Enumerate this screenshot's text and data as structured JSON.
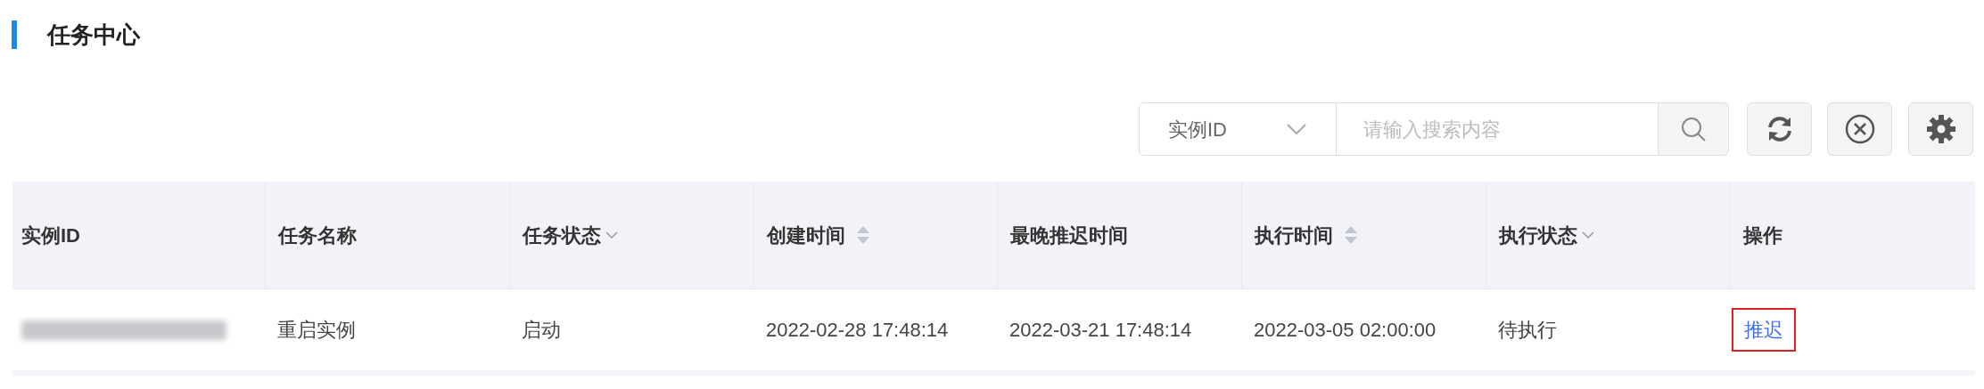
{
  "title": "任务中心",
  "toolbar": {
    "field_select": "实例ID",
    "search": {
      "placeholder": "请输入搜索内容"
    }
  },
  "table": {
    "columns": [
      {
        "label": "实例ID",
        "kind": "plain"
      },
      {
        "label": "任务名称",
        "kind": "plain"
      },
      {
        "label": "任务状态",
        "kind": "filter"
      },
      {
        "label": "创建时间",
        "kind": "sort"
      },
      {
        "label": "最晚推迟时间",
        "kind": "plain"
      },
      {
        "label": "执行时间",
        "kind": "sort"
      },
      {
        "label": "执行状态",
        "kind": "filter"
      },
      {
        "label": "操作",
        "kind": "plain"
      }
    ],
    "rows": [
      {
        "cells": [
          {
            "kind": "redacted"
          },
          {
            "kind": "text",
            "text": "重启实例"
          },
          {
            "kind": "text",
            "text": "启动"
          },
          {
            "kind": "text",
            "text": "2022-02-28 17:48:14"
          },
          {
            "kind": "text",
            "text": "2022-03-21 17:48:14"
          },
          {
            "kind": "text",
            "text": "2022-03-05 02:00:00"
          },
          {
            "kind": "text",
            "text": "待执行"
          },
          {
            "kind": "action",
            "text": "推迟",
            "highlighted": true
          }
        ]
      }
    ]
  }
}
